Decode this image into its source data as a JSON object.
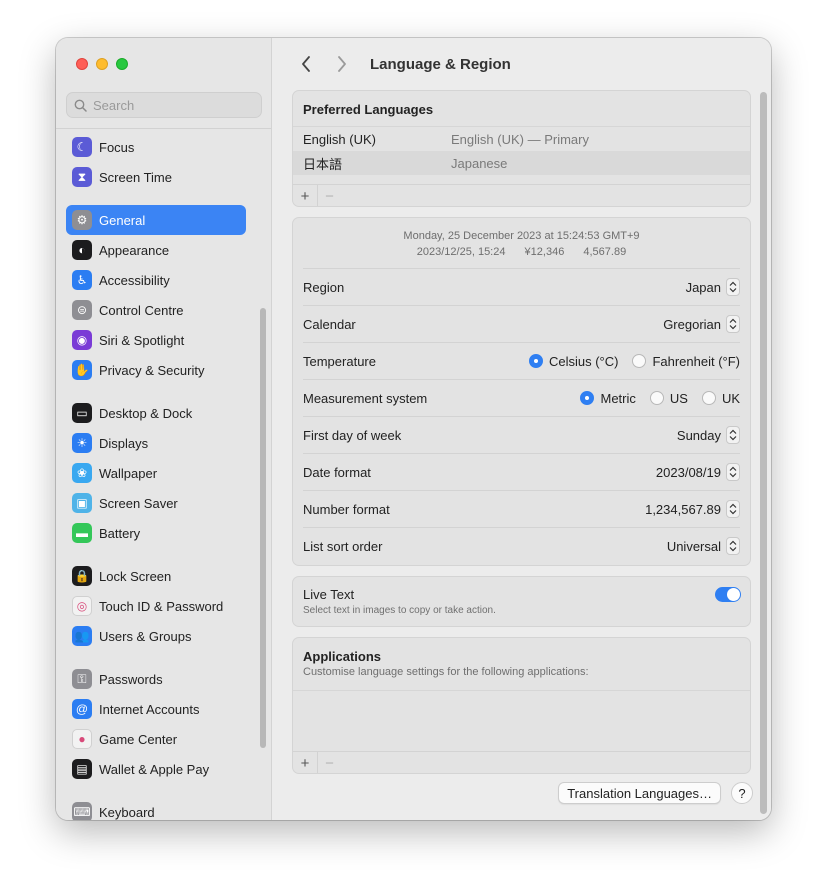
{
  "window": {
    "title": "Language & Region"
  },
  "sidebar": {
    "search_placeholder": "Search",
    "items": [
      {
        "label": "Focus",
        "icon": "moon-icon",
        "color": "#5b5bd6",
        "glyph": "☾"
      },
      {
        "label": "Screen Time",
        "icon": "hourglass-icon",
        "color": "#5b5bd6",
        "glyph": "⧗"
      },
      {
        "label": "General",
        "icon": "gear-icon",
        "color": "#8e8e93",
        "glyph": "⚙",
        "selected": true
      },
      {
        "label": "Appearance",
        "icon": "appearance-icon",
        "color": "#1c1c1e",
        "glyph": "◐"
      },
      {
        "label": "Accessibility",
        "icon": "accessibility-icon",
        "color": "#2b7df2",
        "glyph": "♿"
      },
      {
        "label": "Control Centre",
        "icon": "control-centre-icon",
        "color": "#8e8e93",
        "glyph": "⊜"
      },
      {
        "label": "Siri & Spotlight",
        "icon": "siri-icon",
        "color": "#7a3bd6",
        "glyph": "◉"
      },
      {
        "label": "Privacy & Security",
        "icon": "hand-icon",
        "color": "#2b7df2",
        "glyph": "✋"
      },
      {
        "label": "Desktop & Dock",
        "icon": "dock-icon",
        "color": "#1c1c1e",
        "glyph": "▭"
      },
      {
        "label": "Displays",
        "icon": "sun-icon",
        "color": "#2b7df2",
        "glyph": "☀"
      },
      {
        "label": "Wallpaper",
        "icon": "wallpaper-icon",
        "color": "#39a8f0",
        "glyph": "❀"
      },
      {
        "label": "Screen Saver",
        "icon": "screen-saver-icon",
        "color": "#4fb3e8",
        "glyph": "▣"
      },
      {
        "label": "Battery",
        "icon": "battery-icon",
        "color": "#34c759",
        "glyph": "▬"
      },
      {
        "label": "Lock Screen",
        "icon": "lock-icon",
        "color": "#1c1c1e",
        "glyph": "🔒"
      },
      {
        "label": "Touch ID & Password",
        "icon": "fingerprint-icon",
        "color": "#f2f2f2",
        "glyph": "◎"
      },
      {
        "label": "Users & Groups",
        "icon": "users-icon",
        "color": "#2b7df2",
        "glyph": "👥"
      },
      {
        "label": "Passwords",
        "icon": "key-icon",
        "color": "#8e8e93",
        "glyph": "⚿"
      },
      {
        "label": "Internet Accounts",
        "icon": "at-icon",
        "color": "#2b7df2",
        "glyph": "@"
      },
      {
        "label": "Game Center",
        "icon": "game-center-icon",
        "color": "#f2f2f2",
        "glyph": "●"
      },
      {
        "label": "Wallet & Apple Pay",
        "icon": "wallet-icon",
        "color": "#1c1c1e",
        "glyph": "▤"
      },
      {
        "label": "Keyboard",
        "icon": "keyboard-icon",
        "color": "#8e8e93",
        "glyph": "⌨"
      }
    ]
  },
  "preferred_languages": {
    "title": "Preferred Languages",
    "rows": [
      {
        "name": "English (UK)",
        "detail": "English (UK) — Primary"
      },
      {
        "name": "日本語",
        "detail": "Japanese"
      }
    ],
    "add": "+",
    "remove": "−"
  },
  "format_preview": {
    "line1": "Monday, 25 December 2023 at 15:24:53 GMT+9",
    "line2": [
      "2023/12/25, 15:24",
      "¥12,346",
      "4,567.89"
    ]
  },
  "settings": {
    "region": {
      "label": "Region",
      "value": "Japan"
    },
    "calendar": {
      "label": "Calendar",
      "value": "Gregorian"
    },
    "temperature": {
      "label": "Temperature",
      "opt1": "Celsius (°C)",
      "opt2": "Fahrenheit (°F)",
      "selected": "Celsius (°C)"
    },
    "measurement": {
      "label": "Measurement system",
      "opt1": "Metric",
      "opt2": "US",
      "opt3": "UK",
      "selected": "Metric"
    },
    "first_day": {
      "label": "First day of week",
      "value": "Sunday"
    },
    "date_format": {
      "label": "Date format",
      "value": "2023/08/19"
    },
    "number_format": {
      "label": "Number format",
      "value": "1,234,567.89"
    },
    "list_sort": {
      "label": "List sort order",
      "value": "Universal"
    }
  },
  "live_text": {
    "title": "Live Text",
    "subtitle": "Select text in images to copy or take action.",
    "enabled": true
  },
  "applications": {
    "title": "Applications",
    "subtitle": "Customise language settings for the following applications:",
    "add": "+",
    "remove": "−"
  },
  "footer": {
    "translation_button": "Translation Languages…",
    "help": "?"
  },
  "colors": {
    "accent": "#2f7ff2",
    "selection": "#3b84f4"
  }
}
